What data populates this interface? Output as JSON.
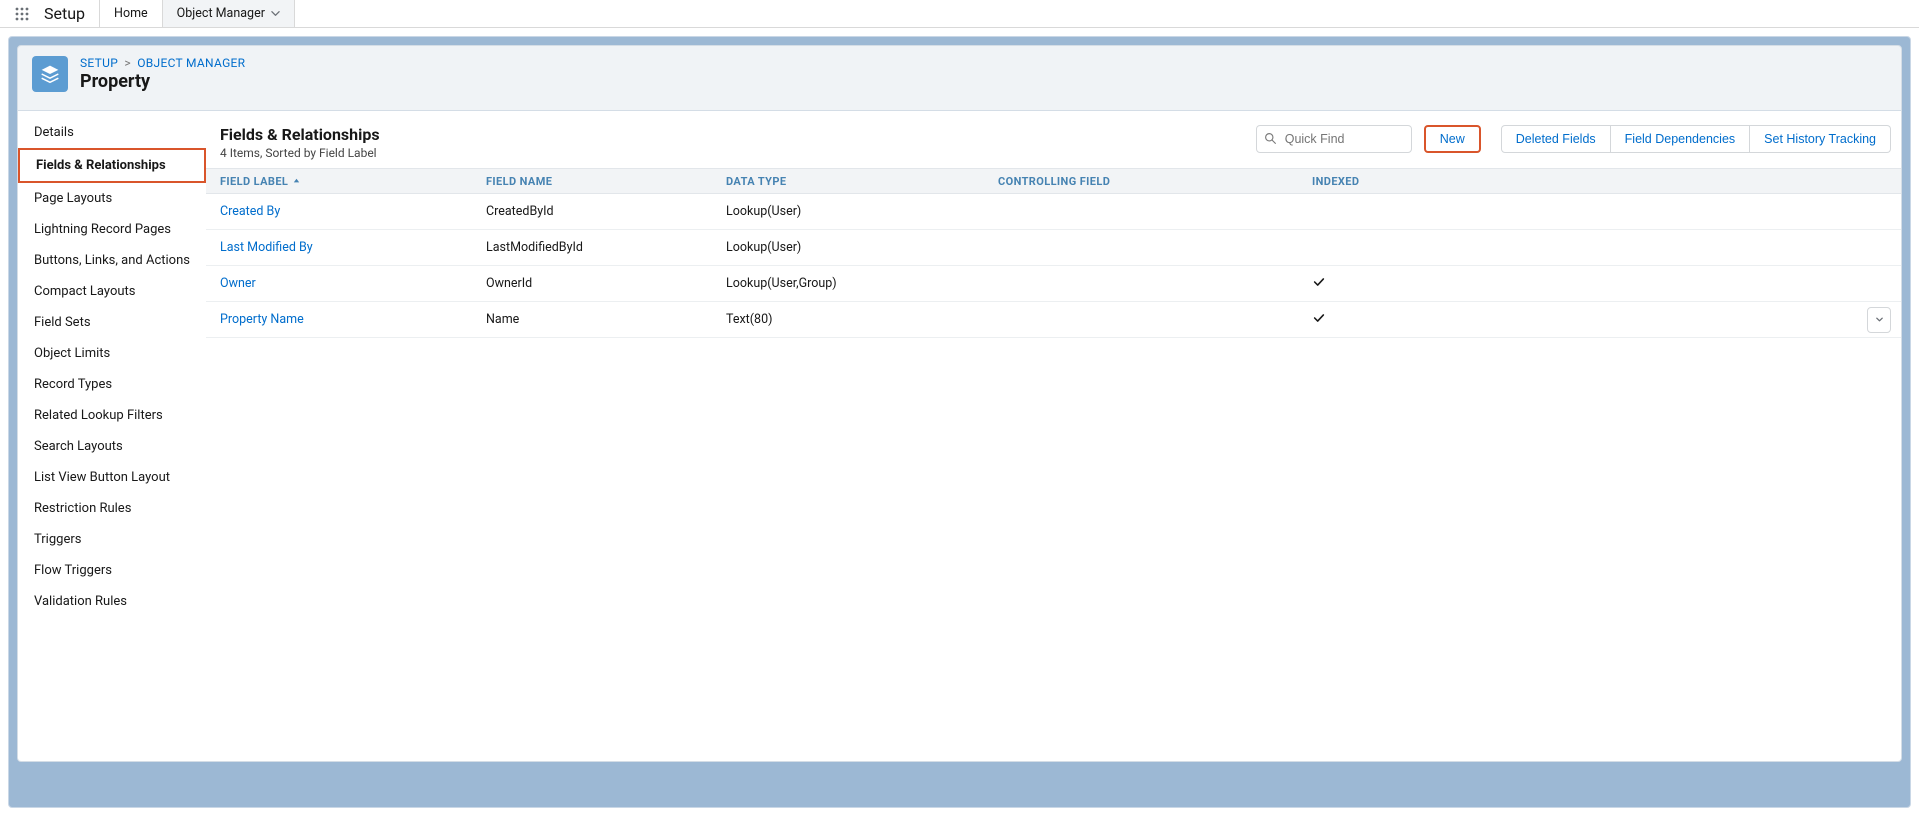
{
  "header": {
    "app_name": "Setup",
    "tabs": [
      {
        "label": "Home",
        "active": false
      },
      {
        "label": "Object Manager",
        "active": true
      }
    ]
  },
  "breadcrumb": {
    "setup": "SETUP",
    "object_manager": "OBJECT MANAGER"
  },
  "page_title": "Property",
  "sidebar": {
    "items": [
      "Details",
      "Fields & Relationships",
      "Page Layouts",
      "Lightning Record Pages",
      "Buttons, Links, and Actions",
      "Compact Layouts",
      "Field Sets",
      "Object Limits",
      "Record Types",
      "Related Lookup Filters",
      "Search Layouts",
      "List View Button Layout",
      "Restriction Rules",
      "Triggers",
      "Flow Triggers",
      "Validation Rules"
    ],
    "selected_index": 1
  },
  "main": {
    "title": "Fields & Relationships",
    "subtitle": "4 Items, Sorted by Field Label",
    "quick_find_placeholder": "Quick Find",
    "actions": {
      "new": "New",
      "deleted_fields": "Deleted Fields",
      "field_dependencies": "Field Dependencies",
      "set_history_tracking": "Set History Tracking"
    },
    "columns": {
      "field_label": "FIELD LABEL",
      "field_name": "FIELD NAME",
      "data_type": "DATA TYPE",
      "controlling_field": "CONTROLLING FIELD",
      "indexed": "INDEXED"
    },
    "rows": [
      {
        "label": "Created By",
        "name": "CreatedById",
        "type": "Lookup(User)",
        "indexed": false,
        "has_menu": false
      },
      {
        "label": "Last Modified By",
        "name": "LastModifiedById",
        "type": "Lookup(User)",
        "indexed": false,
        "has_menu": false
      },
      {
        "label": "Owner",
        "name": "OwnerId",
        "type": "Lookup(User,Group)",
        "indexed": true,
        "has_menu": false
      },
      {
        "label": "Property Name",
        "name": "Name",
        "type": "Text(80)",
        "indexed": true,
        "has_menu": true
      }
    ]
  }
}
